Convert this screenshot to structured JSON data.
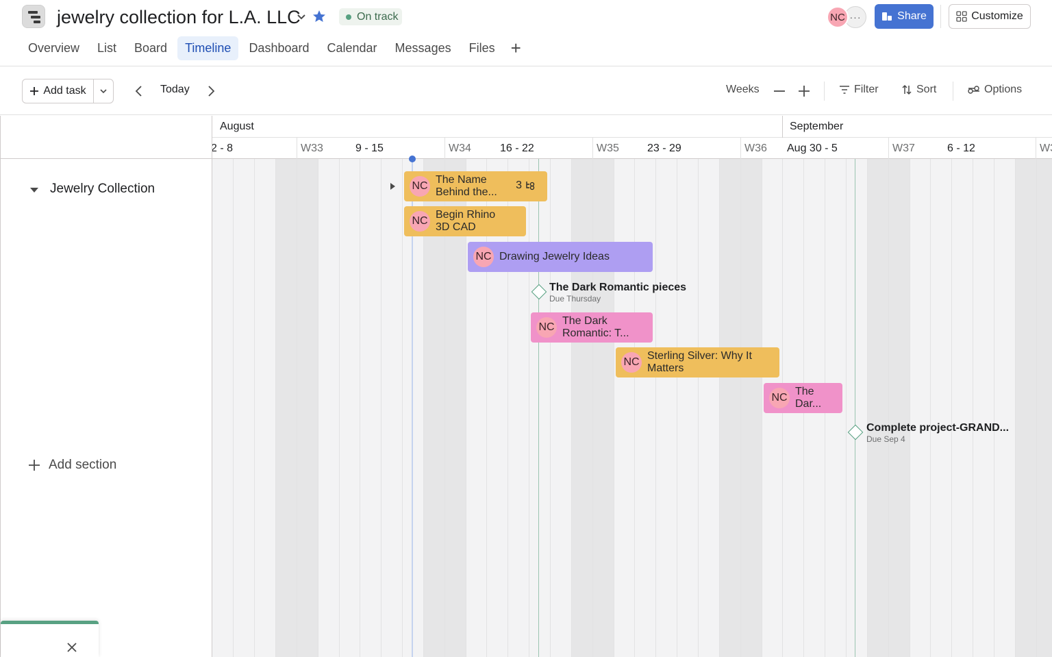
{
  "header": {
    "project_title": "jewelry collection for L.A. LLC",
    "status": "On track",
    "status_color": "#58a182",
    "avatar_initials": "NC",
    "more_label": "···",
    "share_label": "Share",
    "customize_label": "Customize",
    "accent_color": "#4573d2"
  },
  "tabs": [
    {
      "label": "Overview",
      "active": false
    },
    {
      "label": "List",
      "active": false
    },
    {
      "label": "Board",
      "active": false
    },
    {
      "label": "Timeline",
      "active": true
    },
    {
      "label": "Dashboard",
      "active": false
    },
    {
      "label": "Calendar",
      "active": false
    },
    {
      "label": "Messages",
      "active": false
    },
    {
      "label": "Files",
      "active": false
    }
  ],
  "toolbar": {
    "add_task_label": "Add task",
    "today_label": "Today",
    "zoom_label": "Weeks",
    "filter_label": "Filter",
    "sort_label": "Sort",
    "options_label": "Options"
  },
  "sidebar": {
    "section_name": "Jewelry Collection",
    "add_section_label": "Add section"
  },
  "timeline": {
    "months": [
      "August",
      "September"
    ],
    "weeks": [
      {
        "num": "",
        "range": "2 - 8"
      },
      {
        "num": "W33",
        "range": "9 - 15"
      },
      {
        "num": "W34",
        "range": "16 - 22"
      },
      {
        "num": "W35",
        "range": "23 - 29"
      },
      {
        "num": "W36",
        "range": "Aug 30 - 5"
      },
      {
        "num": "W37",
        "range": "6 - 12"
      },
      {
        "num": "W3",
        "range": ""
      }
    ],
    "tasks": [
      {
        "title_line1": "The Name",
        "title_line2": "Behind the...",
        "assignee": "NC",
        "color": "#efbe5c",
        "subtasks": "3"
      },
      {
        "title_line1": "Begin Rhino",
        "title_line2": "3D CAD",
        "assignee": "NC",
        "color": "#efbe5c"
      },
      {
        "title_line1": "Drawing Jewelry Ideas",
        "title_line2": "",
        "assignee": "NC",
        "color": "#ae9ef2"
      },
      {
        "title_line1": "The Dark",
        "title_line2": "Romantic: T...",
        "assignee": "NC",
        "color": "#f092c9"
      },
      {
        "title_line1": "Sterling Silver: Why It",
        "title_line2": "Matters",
        "assignee": "NC",
        "color": "#efbe5c"
      },
      {
        "title_line1": "The",
        "title_line2": "Dar...",
        "assignee": "NC",
        "color": "#f092c9"
      }
    ],
    "milestones": [
      {
        "title": "The Dark Romantic pieces",
        "due": "Due Thursday"
      },
      {
        "title": "Complete project-GRAND...",
        "due": "Due Sep 4"
      }
    ]
  }
}
